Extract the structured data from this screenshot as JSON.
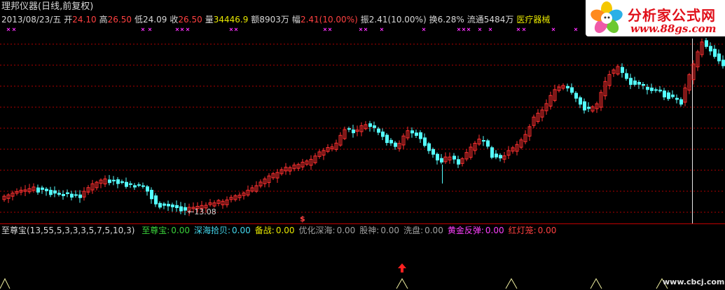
{
  "header": {
    "title": "理邦仪器(日线,前复权)",
    "quote": {
      "date": "2013/08/23/五",
      "open_label": "开",
      "open": "24.10",
      "high_label": "高",
      "high": "26.50",
      "low_label": "低",
      "low": "24.09",
      "close_label": "收",
      "close": "26.50",
      "volume_label": "量",
      "volume": "34446.9",
      "amount_label": "额",
      "amount": "8903万",
      "change_label": "幅",
      "change": "2.41(10.00%)",
      "amplitude_label": "振",
      "amplitude": "2.41(10.00%)",
      "turnover_label": "换",
      "turnover": "6.28%",
      "float_label": "流通",
      "float": "5484万",
      "sector": "医疗器械"
    }
  },
  "chart": {
    "low_annotation": "←13.08",
    "signal_mark": "$",
    "colors": {
      "up": "#ff3030",
      "down": "#54ffff",
      "grid": "#b00000",
      "divider": "#c00000"
    }
  },
  "indicator": {
    "name": "至尊宝(13,55,5,3,3,3,5,7,5,10,3)",
    "fields": [
      {
        "label": "至尊宝:",
        "value": "0.00",
        "color": "#3ad13a"
      },
      {
        "label": "深海拾贝:",
        "value": "0.00",
        "color": "#44d8ee"
      },
      {
        "label": "备战:",
        "value": "0.00",
        "color": "#e8e800"
      },
      {
        "label": "优化深海:",
        "value": "0.00",
        "color": "#a0a0a0"
      },
      {
        "label": "股神:",
        "value": "0.00",
        "color": "#a0a0a0"
      },
      {
        "label": "洗盘:",
        "value": "0.00",
        "color": "#a0a0a0"
      },
      {
        "label": "黄金反弹:",
        "value": "0.00",
        "color": "#ff40ff"
      },
      {
        "label": "红灯笼:",
        "value": "0.00",
        "color": "#ff4040"
      }
    ]
  },
  "logo": {
    "title": "分析家公式网",
    "url": "www.88gs.com"
  },
  "watermark": "www.cbcj.com"
}
